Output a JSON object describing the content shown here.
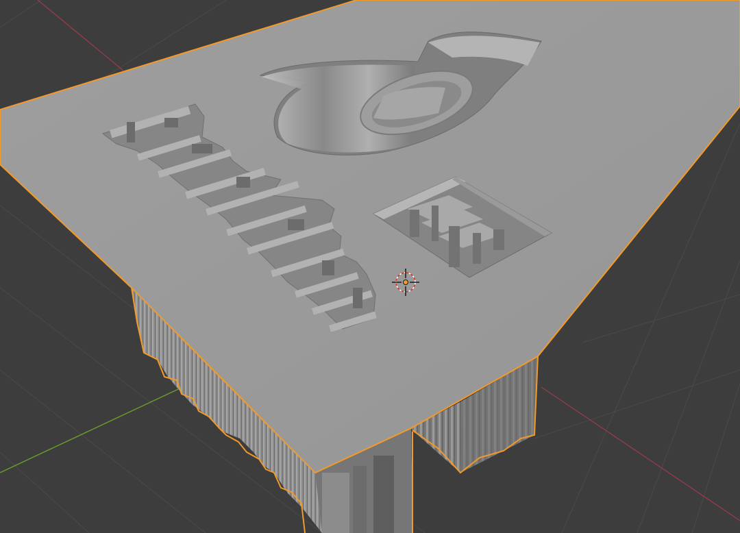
{
  "app": {
    "name": "",
    "view": "3D Viewport"
  },
  "viewport": {
    "background_color": "#3d3d3d",
    "grid_color": "#4a4a4a",
    "x_axis_color": "#9a3b4a",
    "y_axis_color": "#6a9a2e",
    "selection_outline_color": "#f29a2a",
    "object_color": "#9a9a9a",
    "engraving_floor_color": "#7a7a7a",
    "engraving_wall_color": "#b0b0b0",
    "side_wall_color": "#8c8c8c",
    "cursor_color": "#d0342c"
  },
  "scene": {
    "selected_object": "displaced-plane-mesh",
    "engraving_features": [
      "logo-swirl",
      "vertical-text-column",
      "square-stamp"
    ]
  },
  "icons": {
    "cursor": "3d-cursor-icon",
    "origin": "object-origin-icon"
  }
}
